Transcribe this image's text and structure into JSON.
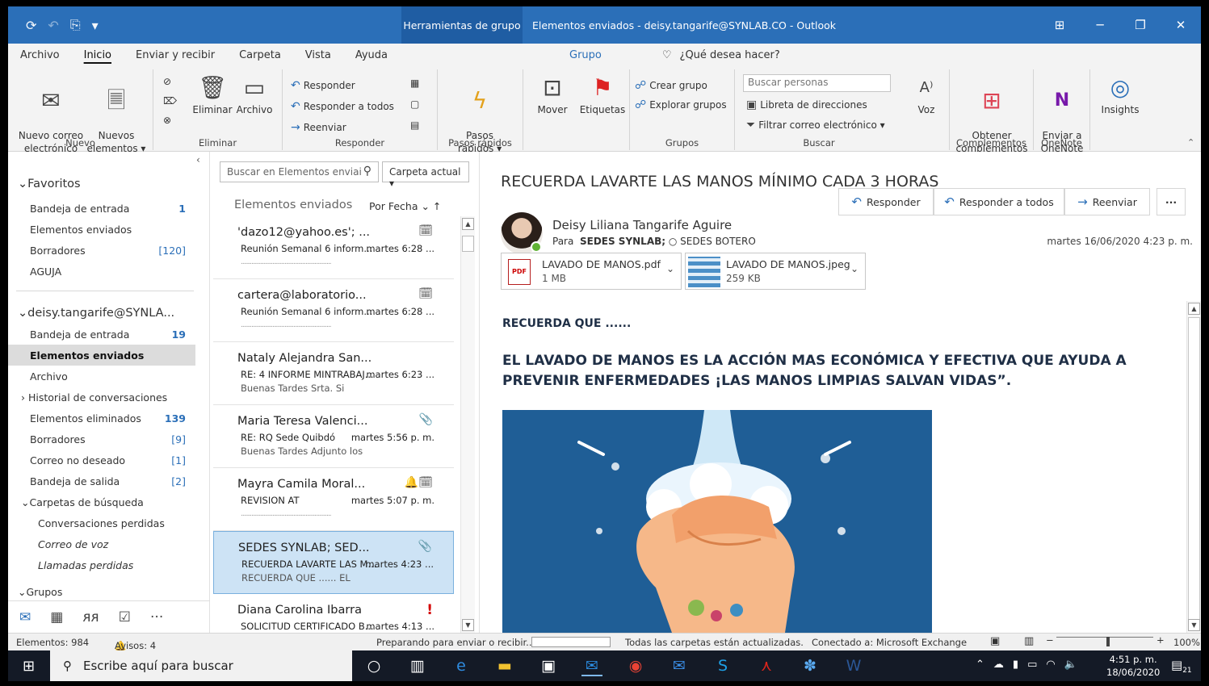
{
  "titlebar": {
    "quick_access": [
      "⟳",
      "↶",
      "⎘",
      "▾"
    ],
    "context_group": "Herramientas de grupo",
    "window_title": "Elementos enviados - deisy.tangarife@SYNLAB.CO  -  Outlook",
    "controls": [
      "⊞",
      "─",
      "❐",
      "✕"
    ]
  },
  "tabs": {
    "items": [
      "Archivo",
      "Inicio",
      "Enviar y recibir",
      "Carpeta",
      "Vista",
      "Ayuda"
    ],
    "active": "Inicio",
    "contextual": "Grupo",
    "tell_me": "¿Qué desea hacer?"
  },
  "ribbon": {
    "nuevo": {
      "label": "Nuevo",
      "new_email": "Nuevo correo\nelectrónico",
      "new_items": "Nuevos\nelementos ▾"
    },
    "eliminar": {
      "label": "Eliminar",
      "delete": "Eliminar",
      "archive": "Archivo"
    },
    "responder": {
      "label": "Responder",
      "reply": "Responder",
      "reply_all": "Responder a todos",
      "forward": "Reenviar"
    },
    "pasos": {
      "label": "Pasos rápidos",
      "btn": "Pasos\nrápidos ▾"
    },
    "mover": {
      "move": "Mover",
      "tags": "Etiquetas"
    },
    "grupos": {
      "label": "Grupos",
      "create": "Crear grupo",
      "browse": "Explorar grupos"
    },
    "buscar": {
      "label": "Buscar",
      "search_people_placeholder": "Buscar personas",
      "address_book": "Libreta de direcciones",
      "filter": "Filtrar correo electrónico ▾"
    },
    "voz": {
      "label": "Voz"
    },
    "complementos": {
      "label": "Complementos",
      "get": "Obtener\ncomplementos"
    },
    "onenote": {
      "label": "OneNote",
      "send": "Enviar a\nOneNote"
    },
    "insights": {
      "label": "Insights"
    }
  },
  "nav": {
    "favorites_header": "Favoritos",
    "favorites": [
      {
        "label": "Bandeja de entrada",
        "count": "1"
      },
      {
        "label": "Elementos enviados",
        "count": ""
      },
      {
        "label": "Borradores",
        "count": "[120]"
      },
      {
        "label": "AGUJA",
        "count": ""
      }
    ],
    "account_header": "deisy.tangarife@SYNLA...",
    "account": [
      {
        "label": "Bandeja de entrada",
        "count": "19"
      },
      {
        "label": "Elementos enviados",
        "count": ""
      },
      {
        "label": "Archivo",
        "count": ""
      },
      {
        "label": "Historial de conversaciones",
        "count": ""
      },
      {
        "label": "Elementos eliminados",
        "count": "139"
      },
      {
        "label": "Borradores",
        "count": "[9]"
      },
      {
        "label": "Correo no deseado",
        "count": "[1]"
      },
      {
        "label": "Bandeja de salida",
        "count": "[2]"
      },
      {
        "label": "Carpetas de búsqueda",
        "count": ""
      },
      {
        "label": "Conversaciones perdidas",
        "count": ""
      },
      {
        "label": "Correo de voz",
        "count": ""
      },
      {
        "label": "Llamadas perdidas",
        "count": ""
      }
    ],
    "groups_header": "Grupos"
  },
  "list": {
    "search_placeholder": "Buscar en Elementos enviai",
    "scope": "Carpeta actual",
    "heading": "Elementos enviados",
    "sort": "Por Fecha ⌄   ↑",
    "messages": [
      {
        "from": "'dazo12@yahoo.es'; ...",
        "subject": "Reunión Semanal 6 inform...",
        "time": "martes 6:28 ...",
        "preview": "",
        "flag": "🗓"
      },
      {
        "from": "cartera@laboratorio...",
        "subject": "Reunión Semanal 6 inform...",
        "time": "martes 6:28 ...",
        "preview": "",
        "flag": "🗓"
      },
      {
        "from": "Nataly Alejandra San...",
        "subject": "RE: 4 INFORME MINTRABAJ...",
        "time": "martes 6:23 ...",
        "preview": "Buenas Tardes Srta.  Si",
        "flag": ""
      },
      {
        "from": "Maria Teresa Valenci...",
        "subject": "RE: RQ Sede Quibdó",
        "time": "martes 5:56 p. m.",
        "preview": "Buenas Tardes  Adjunto los",
        "flag": "📎"
      },
      {
        "from": "Mayra Camila Moral...",
        "subject": "REVISION AT",
        "time": "martes 5:07 p. m.",
        "preview": "",
        "flag": "🔔🗓"
      },
      {
        "from": "SEDES SYNLAB; SED...",
        "subject": "RECUERDA LAVARTE LAS M...",
        "time": "martes 4:23 ...",
        "preview": "RECUERDA QUE ......  EL",
        "flag": "📎"
      },
      {
        "from": "Diana Carolina Ibarra",
        "subject": "SOLICITUD CERTIFICADO B...",
        "time": "martes 4:13 ...",
        "preview": "",
        "flag": "!"
      }
    ]
  },
  "reading": {
    "subject": "RECUERDA LAVARTE LAS MANOS MÍNIMO CADA 3 HORAS",
    "sender": "Deisy Liliana Tangarife Aguire",
    "to_label": "Para",
    "to_bold": "SEDES SYNLAB;",
    "to_rest": "○ SEDES BOTERO",
    "date": "martes 16/06/2020 4:23 p. m.",
    "actions": {
      "reply": "Responder",
      "reply_all": "Responder a todos",
      "forward": "Reenviar",
      "more": "···"
    },
    "attachments": [
      {
        "name": "LAVADO DE MANOS.pdf",
        "size": "1 MB",
        "icon": "PDF"
      },
      {
        "name": "LAVADO DE MANOS.jpeg",
        "size": "259 KB"
      }
    ],
    "body_line1": "RECUERDA QUE ......",
    "body_line2": "EL LAVADO DE MANOS ES LA ACCIÓN MAS ECONÓMICA Y EFECTIVA QUE AYUDA A PREVENIR ENFERMEDADES ¡LAS MANOS LIMPIAS SALVAN VIDAS”."
  },
  "status": {
    "items": "Elementos: 984",
    "reminders": "Avisos: 4",
    "sending": "Preparando para enviar o recibir...",
    "folders": "Todas las carpetas están actualizadas.",
    "connected": "Conectado a: Microsoft Exchange",
    "zoom": "100%"
  },
  "taskbar": {
    "search_placeholder": "Escribe aquí para buscar",
    "time": "4:51 p. m.",
    "date": "18/06/2020",
    "notifications": "21"
  }
}
